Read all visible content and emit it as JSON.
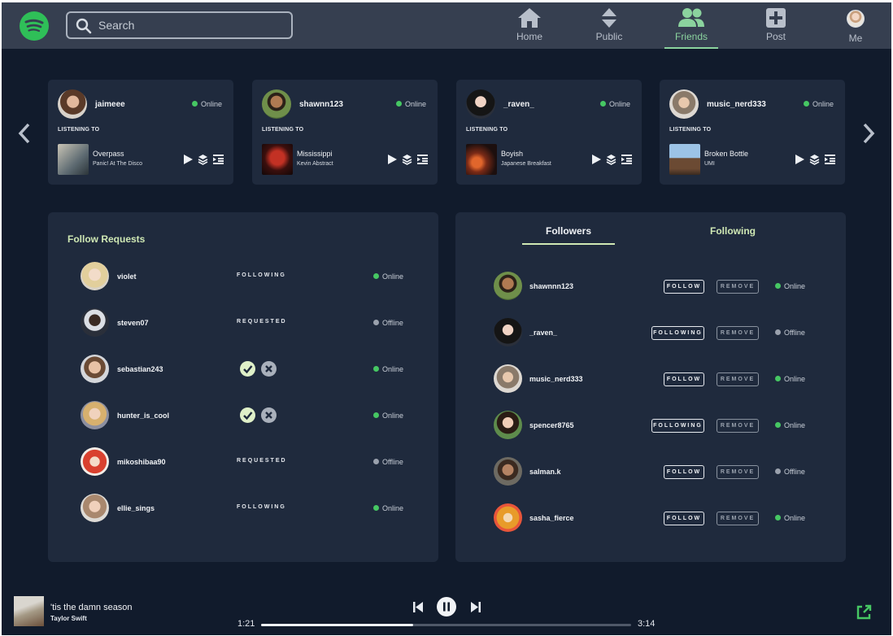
{
  "header": {
    "logo": "spotify-logo",
    "search_placeholder": "Search",
    "nav": [
      {
        "label": "Home",
        "icon": "home-icon"
      },
      {
        "label": "Public",
        "icon": "sort-icon"
      },
      {
        "label": "Friends",
        "icon": "users-icon",
        "active": true
      },
      {
        "label": "Post",
        "icon": "plus-square-icon"
      },
      {
        "label": "Me",
        "icon": "avatar"
      }
    ]
  },
  "activity": {
    "listening_label": "LISTENING TO",
    "cards": [
      {
        "user": "jaimeee",
        "status": "Online",
        "song": "Overpass",
        "artist": "Panic! At The Disco"
      },
      {
        "user": "shawnn123",
        "status": "Online",
        "song": "Mississippi",
        "artist": "Kevin Abstract"
      },
      {
        "user": "_raven_",
        "status": "Online",
        "song": "Boyish",
        "artist": "Japanese Breakfast"
      },
      {
        "user": "music_nerd333",
        "status": "Online",
        "song": "Broken Bottle",
        "artist": "UMI"
      }
    ]
  },
  "requests": {
    "title": "Follow Requests",
    "rows": [
      {
        "user": "violet",
        "state": "FOLLOWING",
        "status": "Online"
      },
      {
        "user": "steven07",
        "state": "REQUESTED",
        "status": "Offline"
      },
      {
        "user": "sebastian243",
        "state": "",
        "status": "Online"
      },
      {
        "user": "hunter_is_cool",
        "state": "",
        "status": "Online"
      },
      {
        "user": "mikoshibaa90",
        "state": "REQUESTED",
        "status": "Offline"
      },
      {
        "user": "ellie_sings",
        "state": "FOLLOWING",
        "status": "Online"
      }
    ]
  },
  "followers": {
    "tabs": [
      "Followers",
      "Following"
    ],
    "remove_label": "REMOVE",
    "rows": [
      {
        "user": "shawnnn123",
        "action": "FOLLOW",
        "status": "Online"
      },
      {
        "user": "_raven_",
        "action": "FOLLOWING",
        "status": "Offline"
      },
      {
        "user": "music_nerd333",
        "action": "FOLLOW",
        "status": "Online"
      },
      {
        "user": "spencer8765",
        "action": "FOLLOWING",
        "status": "Online"
      },
      {
        "user": "salman.k",
        "action": "FOLLOW",
        "status": "Offline"
      },
      {
        "user": "sasha_fierce",
        "action": "FOLLOW",
        "status": "Online"
      }
    ]
  },
  "player": {
    "song": "'tis the damn season",
    "artist": "Taylor Swift",
    "elapsed": "1:21",
    "duration": "3:14",
    "progress": 0.41
  },
  "colors": {
    "accent": "#8bd39e",
    "online": "#46c763",
    "offline": "#9aa1ad",
    "panel": "#1f2a3d",
    "background": "#111b2c"
  }
}
